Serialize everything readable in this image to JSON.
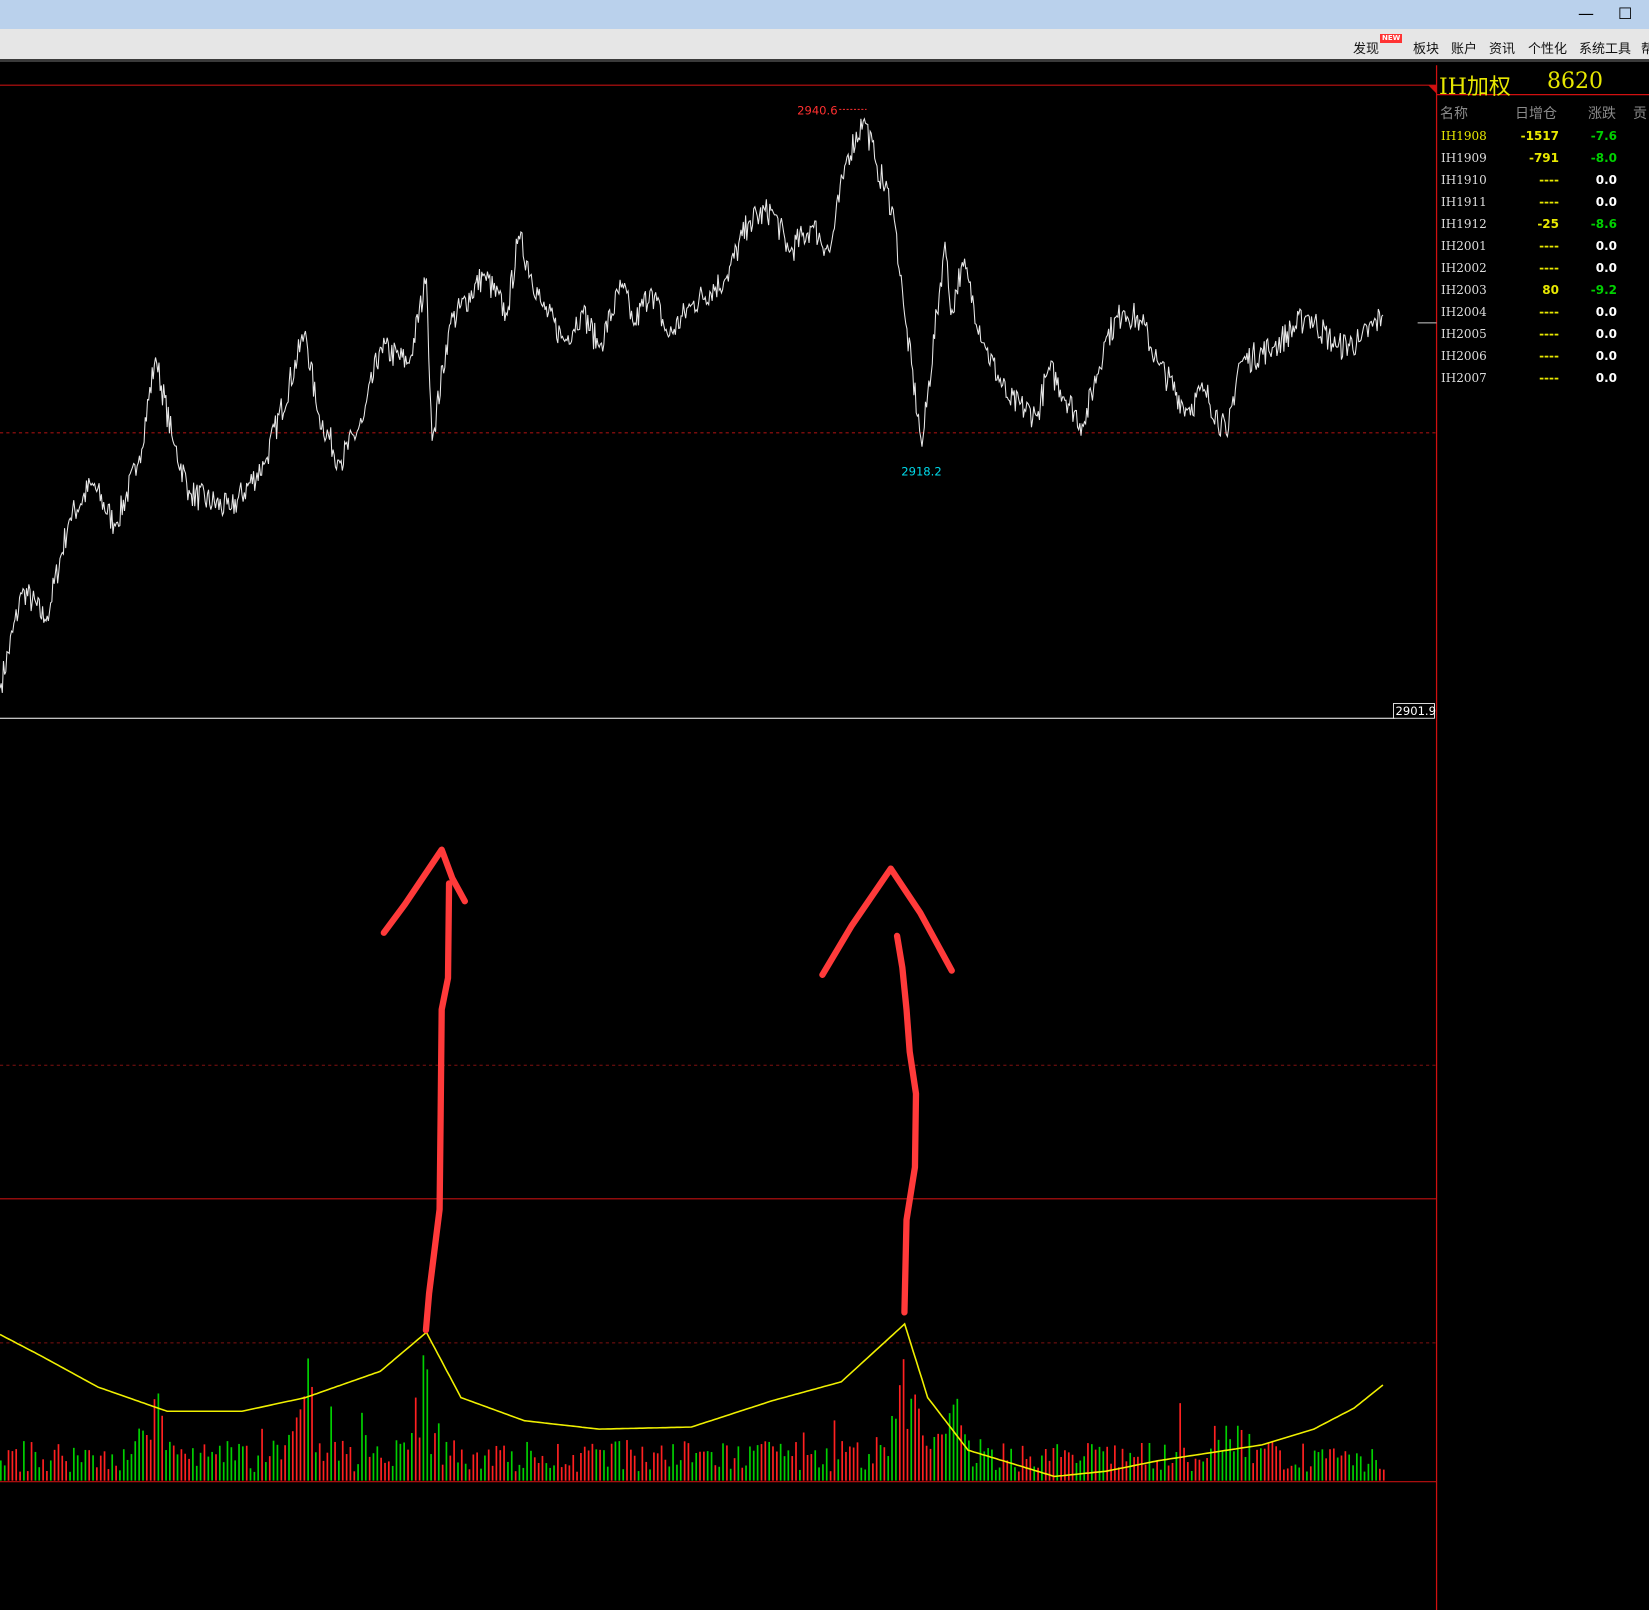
{
  "window": {
    "minimize_icon": "minimize-icon",
    "maximize_icon": "maximize-icon"
  },
  "menu": [
    {
      "label": "发现",
      "badge": "NEW"
    },
    {
      "label": "板块"
    },
    {
      "label": "账户"
    },
    {
      "label": "资讯"
    },
    {
      "label": "个性化"
    },
    {
      "label": "系统工具"
    },
    {
      "label": "帮"
    }
  ],
  "panel": {
    "title": "IH加权",
    "value": "8620",
    "headers": [
      "名称",
      "日增仓",
      "涨跌",
      "贡"
    ],
    "rows": [
      {
        "name": "IH1908",
        "delta": "-1517",
        "change": "-7.6",
        "active": true
      },
      {
        "name": "IH1909",
        "delta": "-791",
        "change": "-8.0"
      },
      {
        "name": "IH1910",
        "delta": "----",
        "change": "0.0"
      },
      {
        "name": "IH1911",
        "delta": "----",
        "change": "0.0"
      },
      {
        "name": "IH1912",
        "delta": "-25",
        "change": "-8.6"
      },
      {
        "name": "IH2001",
        "delta": "----",
        "change": "0.0"
      },
      {
        "name": "IH2002",
        "delta": "----",
        "change": "0.0"
      },
      {
        "name": "IH2003",
        "delta": "80",
        "change": "-9.2"
      },
      {
        "name": "IH2004",
        "delta": "----",
        "change": "0.0"
      },
      {
        "name": "IH2005",
        "delta": "----",
        "change": "0.0"
      },
      {
        "name": "IH2006",
        "delta": "----",
        "change": "0.0"
      },
      {
        "name": "IH2007",
        "delta": "----",
        "change": "0.0"
      }
    ]
  },
  "colors": {
    "up": "#ff2020",
    "down": "#00d000",
    "line": "#e8e8e8",
    "oi": "#f0f000",
    "accent": "#d01010",
    "annot": "#ff3030"
  },
  "chart_data": {
    "type": "line",
    "price": {
      "high_label": "2940.6",
      "low_label": "2918.2",
      "last_label": "2901.9",
      "ylim": [
        2899.7,
        2942.9
      ],
      "ref_level": 2919.15,
      "x": [
        0,
        4,
        8,
        12,
        16,
        20,
        24,
        27,
        30,
        33,
        40,
        46,
        53,
        55,
        59,
        63,
        66,
        71,
        74,
        75,
        78,
        84,
        88,
        90,
        94,
        98,
        101,
        104,
        108,
        110,
        113,
        116,
        120,
        126,
        130,
        134,
        137,
        141,
        144,
        147,
        150,
        152,
        155,
        157,
        160,
        164,
        165,
        167,
        171,
        175,
        180,
        182,
        188,
        192,
        195,
        198,
        201,
        206,
        209,
        213,
        215,
        221,
        227,
        232,
        236,
        240
      ],
      "y": [
        2901.7,
        2908.5,
        2906.3,
        2913.2,
        2915.7,
        2912.8,
        2917.1,
        2924.3,
        2918.6,
        2915.0,
        2913.9,
        2917.1,
        2926.1,
        2920.7,
        2917.1,
        2920.0,
        2925.0,
        2923.9,
        2929.7,
        2918.6,
        2926.5,
        2930.0,
        2927.2,
        2932.6,
        2927.9,
        2925.4,
        2927.5,
        2925.0,
        2929.3,
        2926.5,
        2929.0,
        2925.7,
        2927.9,
        2929.7,
        2933.6,
        2934.4,
        2931.5,
        2933.3,
        2931.5,
        2938.0,
        2940.6,
        2937.6,
        2934.4,
        2927.2,
        2918.2,
        2932.2,
        2927.2,
        2930.8,
        2925.0,
        2921.4,
        2920.3,
        2923.6,
        2919.6,
        2925.7,
        2927.5,
        2926.8,
        2923.9,
        2920.7,
        2922.1,
        2918.9,
        2923.9,
        2925.0,
        2927.2,
        2925.0,
        2925.4,
        2927.2
      ]
    },
    "open_interest": {
      "x": [
        0,
        7,
        17,
        29,
        42,
        53,
        66,
        74,
        80,
        91,
        104,
        120,
        134,
        146,
        157,
        161,
        168,
        183,
        192,
        201,
        219,
        228,
        235,
        240
      ],
      "y": [
        140,
        120,
        90,
        67,
        67,
        80,
        105,
        142,
        80,
        58,
        50,
        52,
        77,
        95,
        150,
        80,
        30,
        5,
        10,
        20,
        35,
        50,
        70,
        92
      ]
    },
    "volume_peaks": [
      {
        "x": 27,
        "v": 100
      },
      {
        "x": 53,
        "v": 100
      },
      {
        "x": 74,
        "v": 135
      },
      {
        "x": 157,
        "v": 140
      },
      {
        "x": 165,
        "v": 95
      },
      {
        "x": 213,
        "v": 62
      }
    ]
  },
  "annotations": {
    "arrows": 2
  }
}
